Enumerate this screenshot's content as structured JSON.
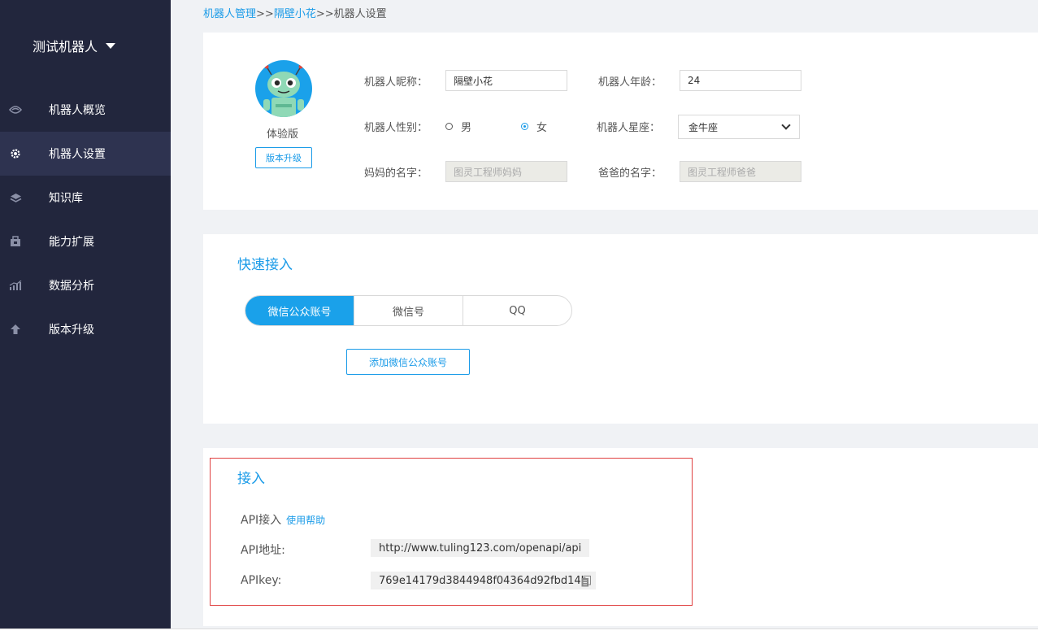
{
  "sidebar": {
    "title": "测试机器人",
    "items": [
      {
        "label": "机器人概览",
        "icon": "eye-icon"
      },
      {
        "label": "机器人设置",
        "icon": "gear-icon"
      },
      {
        "label": "知识库",
        "icon": "layers-icon"
      },
      {
        "label": "能力扩展",
        "icon": "extension-icon"
      },
      {
        "label": "数据分析",
        "icon": "chart-icon"
      },
      {
        "label": "版本升级",
        "icon": "upload-arrow-icon"
      }
    ],
    "active_index": 1
  },
  "breadcrumb": {
    "root": "机器人管理",
    "sep1": ">>",
    "robot": "隔壁小花",
    "sep2": ">>",
    "current": "机器人设置"
  },
  "profile": {
    "version": "体验版",
    "upgrade_label": "版本升级",
    "nickname_label": "机器人昵称：",
    "nickname_value": "隔壁小花",
    "age_label": "机器人年龄：",
    "age_value": "24",
    "gender_label": "机器人性别：",
    "gender_male": "男",
    "gender_female": "女",
    "gender_selected": "女",
    "zodiac_label": "机器人星座：",
    "zodiac_value": "金牛座",
    "mother_label": "妈妈的名字：",
    "mother_value": "图灵工程师妈妈",
    "father_label": "爸爸的名字：",
    "father_value": "图灵工程师爸爸"
  },
  "quick": {
    "title": "快速接入",
    "tabs": [
      "微信公众账号",
      "微信号",
      "QQ"
    ],
    "active_tab": 0,
    "add_label": "添加微信公众账号"
  },
  "api": {
    "title": "接入",
    "api_access_label": "API接入",
    "help_link": "使用帮助",
    "address_label": "API地址:",
    "address_value": "http://www.tuling123.com/openapi/api",
    "key_label": "APIkey:",
    "key_value": "769e14179d3844948f04364d92fbd14b"
  },
  "colors": {
    "accent": "#1a9be8",
    "sidebar_bg": "#22263d",
    "highlight_border": "#e04040"
  }
}
